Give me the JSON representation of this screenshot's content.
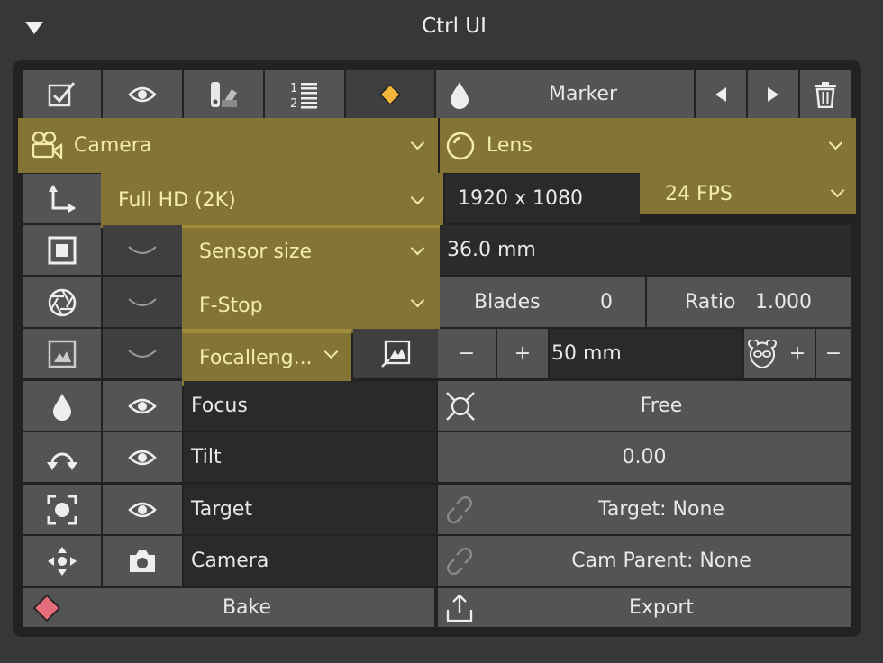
{
  "window": {
    "title": "Ctrl UI"
  },
  "toolbar": {
    "marker_label": "Marker"
  },
  "camera": {
    "dropdown": "Camera"
  },
  "lens": {
    "dropdown": "Lens"
  },
  "resolution": {
    "preset": "Full HD (2K)",
    "value": "1920 x 1080",
    "fps": "24 FPS"
  },
  "sensor": {
    "dropdown": "Sensor size",
    "value": "36.0 mm"
  },
  "fstop": {
    "dropdown": "F-Stop",
    "blades_label": "Blades",
    "blades_value": "0",
    "ratio_label": "Ratio",
    "ratio_value": "1.000"
  },
  "focal": {
    "dropdown": "Focalleng...",
    "minus": "−",
    "plus": "+",
    "value": "50 mm",
    "minus2": "+",
    "plus2": "−"
  },
  "rows": {
    "focus": {
      "label": "Focus",
      "value": "Free"
    },
    "tilt": {
      "label": "Tilt",
      "value": "0.00"
    },
    "target": {
      "label": "Target",
      "value": "Target: None"
    },
    "camera": {
      "label": "Camera",
      "value": "Cam Parent: None"
    }
  },
  "footer": {
    "bake": "Bake",
    "export": "Export"
  },
  "colors": {
    "highlight": "#aa963c",
    "marker_diamond": "#f0b43a",
    "bake_diamond": "#e46c7b"
  }
}
